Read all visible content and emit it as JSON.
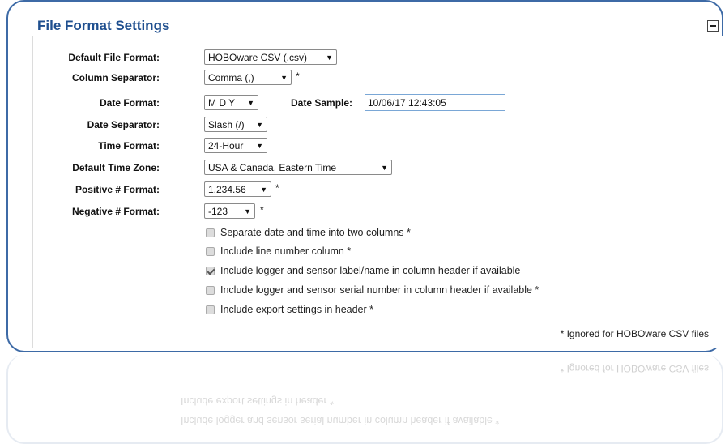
{
  "panel": {
    "title": "File Format Settings"
  },
  "fields": {
    "default_file_format": {
      "label": "Default File Format:",
      "value": "HOBOware CSV (.csv)"
    },
    "column_separator": {
      "label": "Column Separator:",
      "value": "Comma (,)",
      "star": "*"
    },
    "date_format": {
      "label": "Date Format:",
      "value": "M D Y"
    },
    "date_sample": {
      "label": "Date Sample:",
      "value": "10/06/17 12:43:05"
    },
    "date_separator": {
      "label": "Date Separator:",
      "value": "Slash (/)"
    },
    "time_format": {
      "label": "Time Format:",
      "value": "24-Hour"
    },
    "default_time_zone": {
      "label": "Default Time Zone:",
      "value": "USA & Canada, Eastern Time"
    },
    "positive_format": {
      "label": "Positive # Format:",
      "value": "1,234.56",
      "star": "*"
    },
    "negative_format": {
      "label": "Negative # Format:",
      "value": "-123",
      "star": "*"
    }
  },
  "checkboxes": [
    {
      "label": "Separate date and time into two columns *",
      "checked": false
    },
    {
      "label": "Include line number column *",
      "checked": false
    },
    {
      "label": "Include logger and sensor label/name in column header if available",
      "checked": true
    },
    {
      "label": "Include logger and sensor serial number in column header if available *",
      "checked": false
    },
    {
      "label": "Include export settings in header *",
      "checked": false
    }
  ],
  "footnote": "* Ignored for HOBOware CSV files",
  "icons": {
    "collapse": "minus-box-icon",
    "dropdown": "triangle-down-icon",
    "check": "checkmark-icon"
  },
  "colors": {
    "title": "#1f4f8f",
    "panel_border": "#3d6aa6"
  }
}
